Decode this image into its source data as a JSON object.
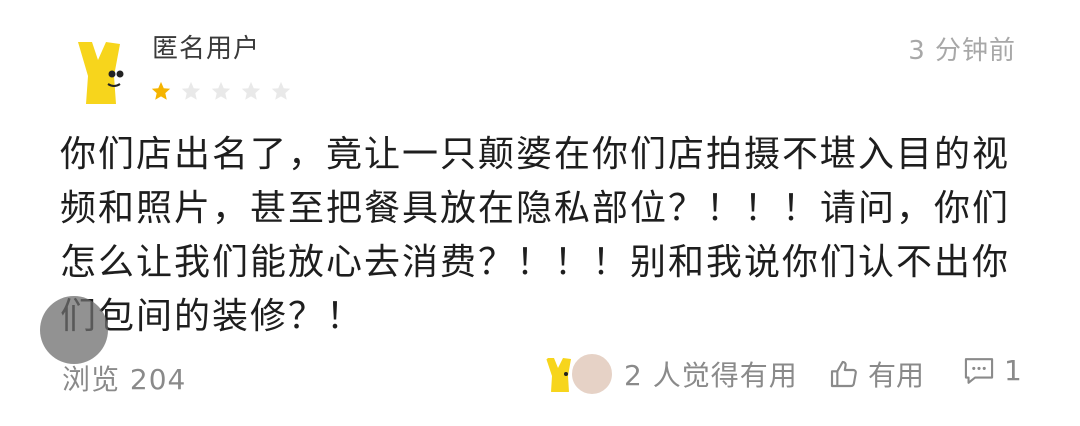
{
  "review": {
    "username": "匿名用户",
    "time": "3 分钟前",
    "rating": 1,
    "max_rating": 5,
    "content": "你们店出名了，竟让一只颠婆在你们店拍摄不堪入目的视频和照片，甚至把餐具放在隐私部位？！！！请问，你们怎么让我们能放心去消费？！！！别和我说你们认不出你们包间的装修？！"
  },
  "footer": {
    "views": "浏览 204",
    "helpful": "2 人觉得有用",
    "useful_label": "有用",
    "comment_count": "1"
  },
  "colors": {
    "star_active": "#f5b400",
    "star_inactive": "#e9e9e9",
    "avatar_yellow": "#f7d51c"
  },
  "icons": [
    "mascot-avatar-icon",
    "star-icon",
    "thumbs-up-icon",
    "comment-icon"
  ]
}
